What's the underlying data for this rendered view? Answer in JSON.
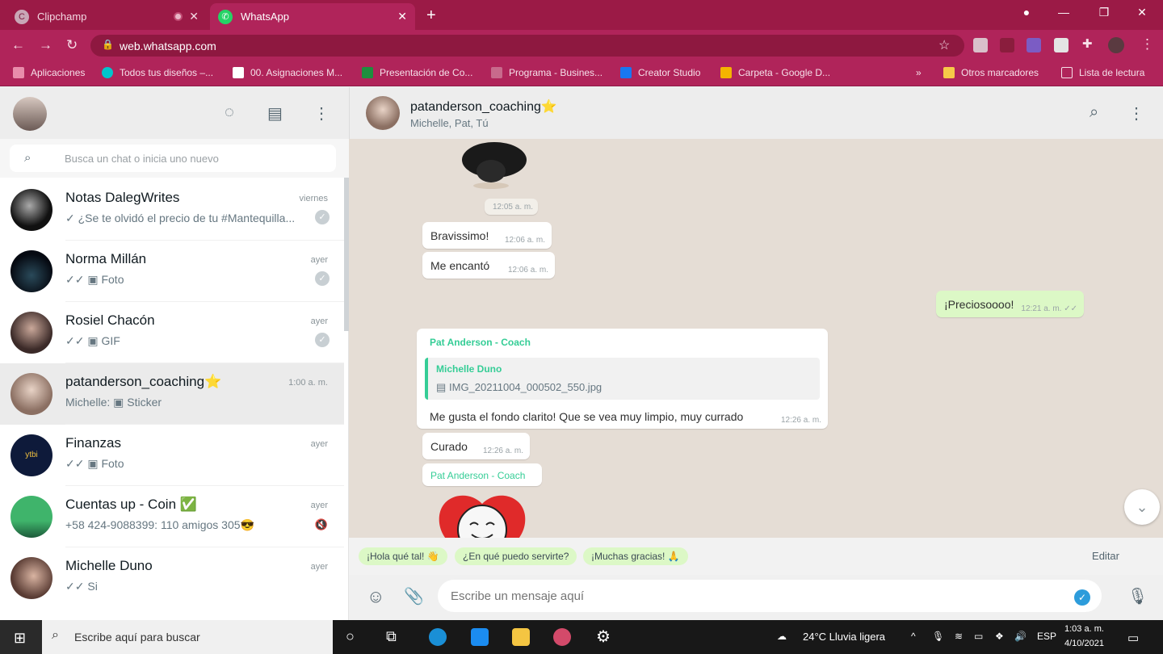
{
  "browser": {
    "tabs": [
      {
        "label": "Clipchamp",
        "active": false
      },
      {
        "label": "WhatsApp",
        "active": true
      }
    ],
    "new_tab_label": "+",
    "url": "web.whatsapp.com",
    "bookmarks": [
      {
        "label": "Aplicaciones"
      },
      {
        "label": "Todos tus diseños –..."
      },
      {
        "label": "00. Asignaciones M..."
      },
      {
        "label": "Presentación de Co..."
      },
      {
        "label": "Programa - Busines..."
      },
      {
        "label": "Creator Studio"
      },
      {
        "label": "Carpeta - Google D..."
      }
    ],
    "bookmarks_more": "»",
    "other_bookmarks": "Otros marcadores",
    "reading_list": "Lista de lectura",
    "accent_color": "#b0245a"
  },
  "sidebar": {
    "search_placeholder": "Busca un chat o inicia uno nuevo",
    "chats": [
      {
        "name": "Notas DalegWrites",
        "preview": "✓ ¿Se te olvidó el precio de tu #Mantequilla...",
        "time": "viernes"
      },
      {
        "name": "Norma Millán",
        "preview": "✓✓ ▣ Foto",
        "time": "ayer"
      },
      {
        "name": "Rosiel Chacón",
        "preview": "✓✓ ▣ GIF",
        "time": "ayer"
      },
      {
        "name": "patanderson_coaching⭐",
        "preview": "Michelle: ▣ Sticker",
        "time": "1:00 a. m."
      },
      {
        "name": "Finanzas",
        "preview": "✓✓ ▣ Foto",
        "time": "ayer"
      },
      {
        "name": "Cuentas up - Coin ✅",
        "preview": "+58 424-9088399: 110 amigos 305😎",
        "time": "ayer"
      },
      {
        "name": "Michelle Duno",
        "preview": "✓✓ Si",
        "time": "ayer"
      }
    ]
  },
  "conversation": {
    "name": "patanderson_coaching⭐",
    "members": "Michelle, Pat, Tú",
    "sticker_time": "12:05 a. m.",
    "messages": [
      {
        "text": "Bravissimo!",
        "time": "12:06 a. m."
      },
      {
        "text": "Me encantó",
        "time": "12:06 a. m."
      },
      {
        "text": "¡Preciosoooo!",
        "time": "12:21 a. m. ✓✓"
      },
      {
        "sender": "Pat Anderson - Coach",
        "quote_sender": "Michelle Duno",
        "quote_file": "IMG_20211004_000502_550.jpg",
        "text": "Me gusta el fondo clarito! Que se vea muy limpio, muy currado",
        "time": "12:26 a. m."
      },
      {
        "text": "Curado",
        "time": "12:26 a. m."
      },
      {
        "sender": "Pat Anderson - Coach"
      }
    ],
    "quick_replies": [
      "¡Hola qué tal! 👋",
      "¿En qué puedo servirte?",
      "¡Muchas gracias! 🙏"
    ],
    "edit_label": "Editar",
    "input_placeholder": "Escribe un mensaje aquí"
  },
  "taskbar": {
    "search_placeholder": "Escribe aquí para buscar",
    "weather": "24°C  Lluvia ligera",
    "language": "ESP",
    "time": "1:03 a. m.",
    "date": "4/10/2021"
  }
}
